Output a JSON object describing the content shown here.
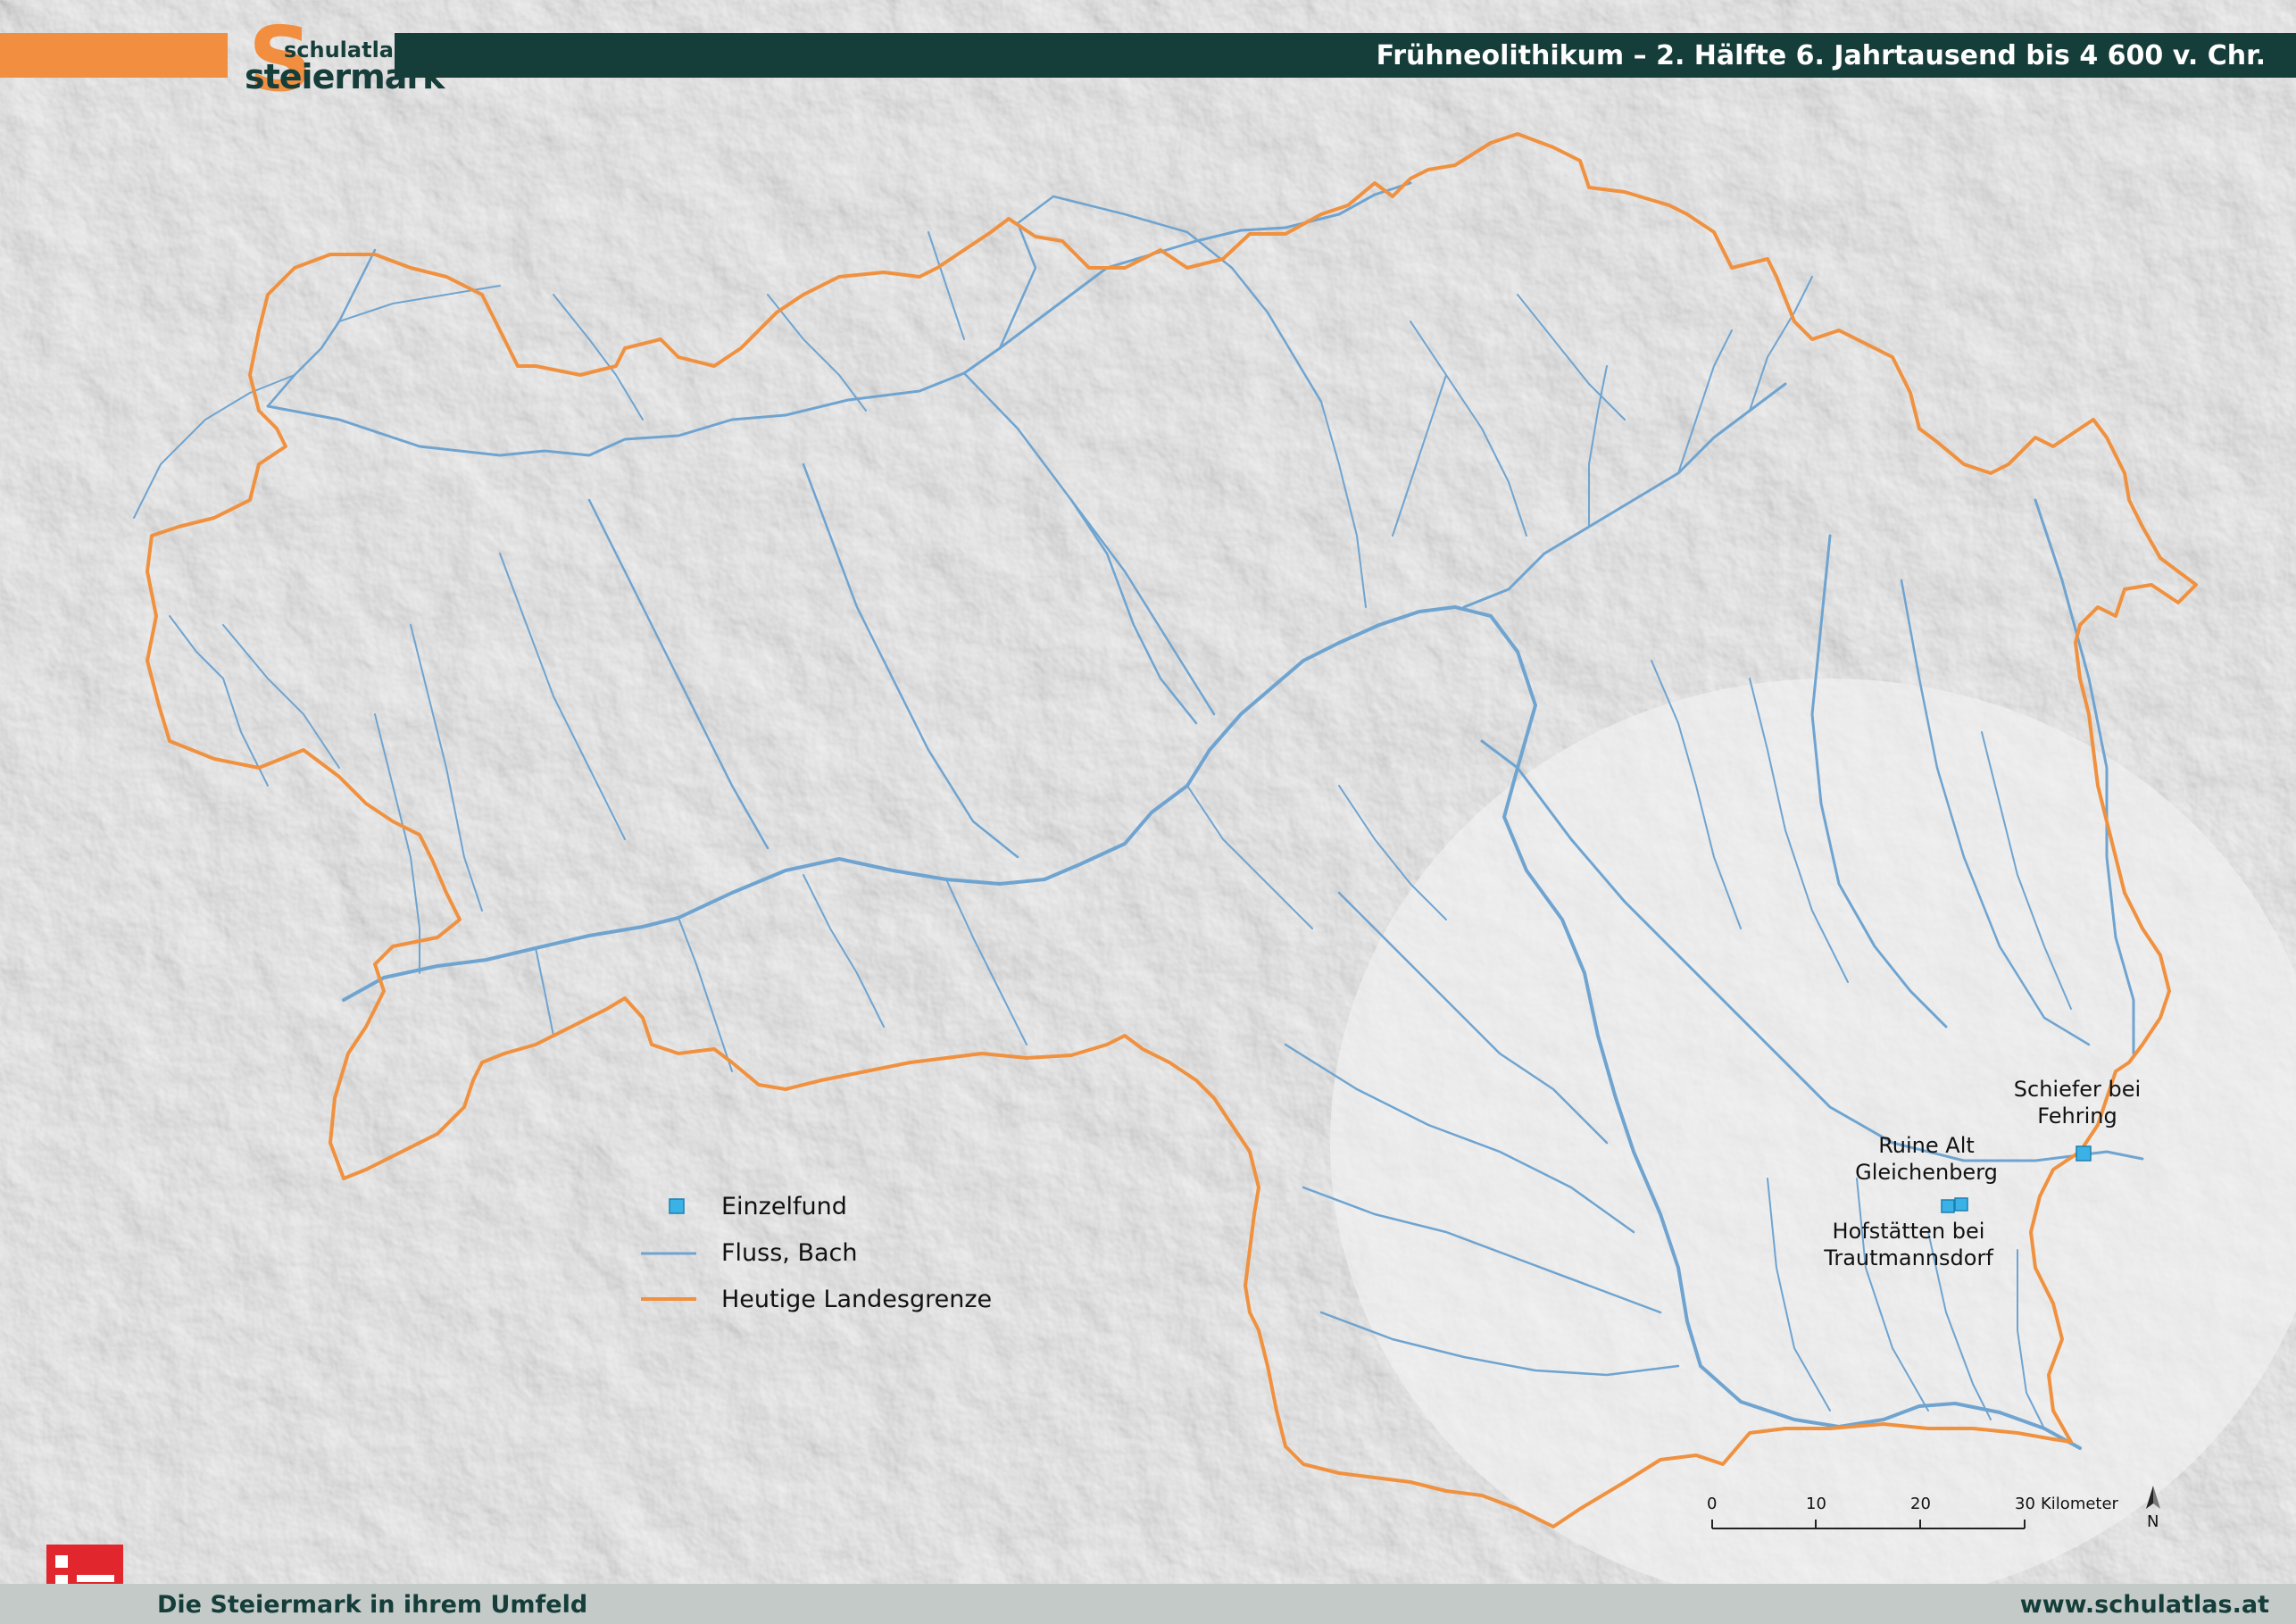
{
  "header": {
    "title": "Frühneolithikum – 2. Hälfte 6. Jahrtausend bis 4 600 v. Chr.",
    "logo_top": "schulatlas",
    "logo_bottom": "steiermark",
    "logo_letter": "S"
  },
  "map": {
    "finds": [
      {
        "name": "Schiefer bei Fehring",
        "label_line1": "Schiefer bei",
        "label_line2": "Fehring"
      },
      {
        "name": "Ruine Alt Gleichenberg",
        "label_line1": "Ruine Alt",
        "label_line2": "Gleichenberg"
      },
      {
        "name": "Hofstätten bei Trautmannsdorf",
        "label_line1": "Hofstätten bei",
        "label_line2": "Trautmannsdorf"
      }
    ]
  },
  "legend": {
    "items": [
      {
        "label": "Einzelfund",
        "symbol": "square",
        "color": "#3ab2e6"
      },
      {
        "label": "Fluss, Bach",
        "symbol": "line",
        "color": "#6fa4d0"
      },
      {
        "label": "Heutige Landesgrenze",
        "symbol": "line",
        "color": "#f0913f"
      }
    ]
  },
  "scale_bar": {
    "ticks": [
      "0",
      "10",
      "20",
      "30"
    ],
    "unit": "Kilometer",
    "north_label": "N"
  },
  "footer": {
    "left": "Die Steiermark in ihrem Umfeld",
    "right": "www.schulatlas.at"
  },
  "colors": {
    "border": "#f0913f",
    "river": "#6fa4d0",
    "find": "#3ab2e6",
    "header_dark": "#153d39",
    "header_orange": "#f28e3f",
    "footer_bar": "#c4cac8",
    "footer_icon": "#e1262d"
  }
}
